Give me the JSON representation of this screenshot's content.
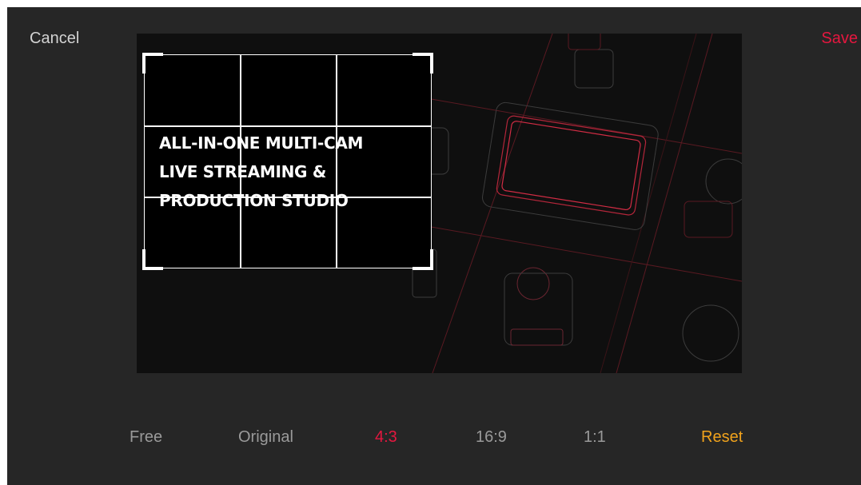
{
  "header": {
    "cancel_label": "Cancel",
    "save_label": "Save"
  },
  "image": {
    "promo_lines": [
      "ALL-IN-ONE MULTI-CAM",
      "LIVE STREAMING &",
      "PRODUCTION STUDIO"
    ]
  },
  "ratio_options": [
    {
      "label": "Free",
      "selected": false
    },
    {
      "label": "Original",
      "selected": false
    },
    {
      "label": "4:3",
      "selected": true
    },
    {
      "label": "16:9",
      "selected": false
    },
    {
      "label": "1:1",
      "selected": false
    }
  ],
  "reset_label": "Reset",
  "colors": {
    "accent": "#e5173f",
    "reset": "#f0a21c",
    "background": "#262626",
    "inactive_text": "#9a9a9a"
  }
}
